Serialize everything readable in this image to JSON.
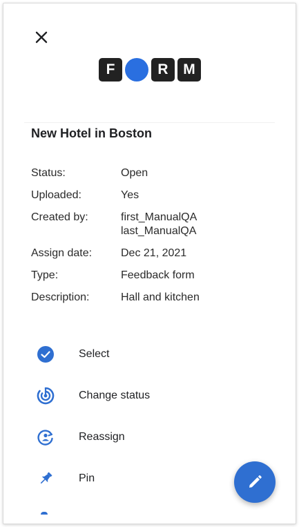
{
  "colors": {
    "accent": "#2f6fd1",
    "logo_dot": "#2a6fe0",
    "logo_tile": "#222222"
  },
  "header": {
    "close_icon": "close-icon"
  },
  "logo": {
    "letters": [
      "F",
      "R",
      "M"
    ]
  },
  "record": {
    "title": "New Hotel in Boston",
    "details": [
      {
        "label": "Status:",
        "value": "Open"
      },
      {
        "label": "Uploaded:",
        "value": "Yes"
      },
      {
        "label": "Created by:",
        "value": "first_ManualQA\nlast_ManualQA"
      },
      {
        "label": "Assign date:",
        "value": "Dec 21, 2021"
      },
      {
        "label": "Type:",
        "value": "Feedback form"
      },
      {
        "label": "Description:",
        "value": "Hall and kitchen"
      }
    ]
  },
  "actions": [
    {
      "label": "Select",
      "icon": "check-circle-icon"
    },
    {
      "label": "Change status",
      "icon": "status-icon"
    },
    {
      "label": "Reassign",
      "icon": "reassign-icon"
    },
    {
      "label": "Pin",
      "icon": "pin-icon"
    }
  ],
  "fab": {
    "icon": "edit-pencil-icon"
  }
}
